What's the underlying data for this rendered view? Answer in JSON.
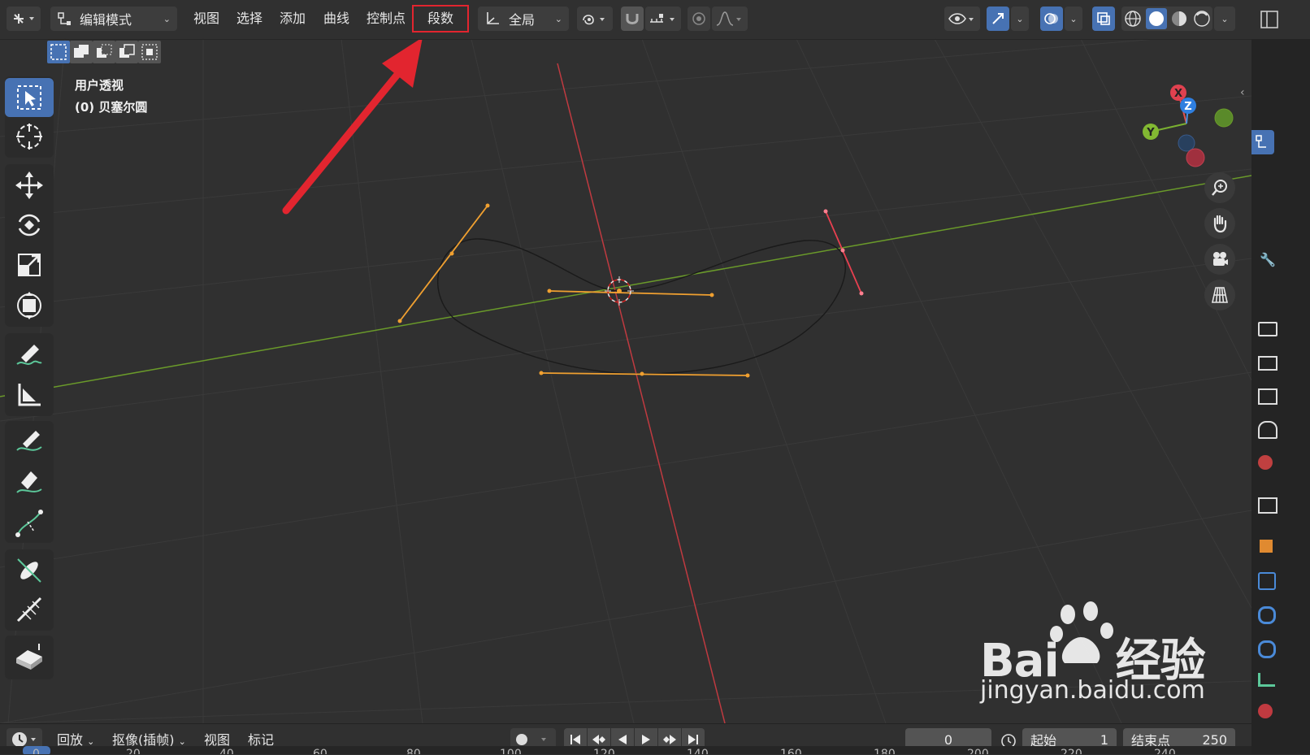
{
  "header": {
    "mode_label": "编辑模式",
    "menus": [
      "视图",
      "选择",
      "添加",
      "曲线",
      "控制点",
      "段数"
    ],
    "highlighted_menu": "段数",
    "transform_orientation": "全局"
  },
  "viewport": {
    "view_name": "用户透视",
    "object_name": "(0) 贝塞尔圆",
    "gizmo": {
      "x": "X",
      "y": "Y",
      "z": "Z"
    }
  },
  "timeline": {
    "playback_label": "回放",
    "keying_label": "抠像(插帧)",
    "view_label": "视图",
    "marker_label": "标记",
    "current_frame": "0",
    "start_label": "起始",
    "start_value": "1",
    "end_label": "结束点",
    "end_value": "250",
    "ruler_ticks": [
      "0",
      "20",
      "40",
      "60",
      "80",
      "100",
      "120",
      "140",
      "160",
      "180",
      "200",
      "220",
      "240"
    ]
  },
  "watermark": {
    "brand": "Bai",
    "brand_cn": "经验",
    "url": "jingyan.baidu.com"
  },
  "colors": {
    "accent_blue": "#4772b3",
    "highlight_red": "#e2252f",
    "handle_orange": "#f0a030",
    "axis_x_red": "#c03a40",
    "axis_y_green": "#6a9a2a"
  }
}
